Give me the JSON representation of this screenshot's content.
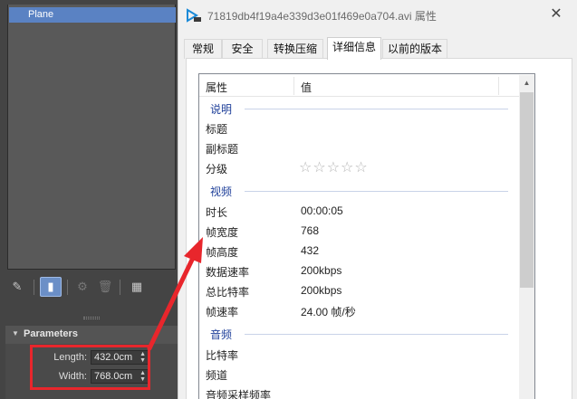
{
  "outliner": {
    "selected_item": "Plane"
  },
  "parameters": {
    "title": "Parameters",
    "length_label": "Length:",
    "length_value": "432.0cm",
    "width_label": "Width:",
    "width_value": "768.0cm"
  },
  "dialog": {
    "title": "71819db4f19a4e339d3e01f469e0a704.avi 属性",
    "close": "✕",
    "tabs": [
      "常规",
      "安全",
      "转换压缩",
      "详细信息",
      "以前的版本"
    ],
    "active_tab": "详细信息",
    "columns": {
      "property": "属性",
      "value": "值"
    },
    "groups": {
      "description": "说明",
      "video": "视频",
      "audio": "音频"
    },
    "rows": {
      "title": {
        "label": "标题",
        "value": ""
      },
      "subtitle": {
        "label": "副标题",
        "value": ""
      },
      "rating": {
        "label": "分级",
        "stars": "☆☆☆☆☆"
      },
      "length": {
        "label": "时长",
        "value": "00:00:05"
      },
      "frame_width": {
        "label": "帧宽度",
        "value": "768"
      },
      "frame_height": {
        "label": "帧高度",
        "value": "432"
      },
      "data_rate": {
        "label": "数据速率",
        "value": "200kbps"
      },
      "total_bitrate": {
        "label": "总比特率",
        "value": "200kbps"
      },
      "frame_rate": {
        "label": "帧速率",
        "value": "24.00 帧/秒"
      },
      "bitrate": {
        "label": "比特率",
        "value": ""
      },
      "channels": {
        "label": "频道",
        "value": ""
      },
      "audio_sample_rate": {
        "label": "音频采样频率",
        "value": ""
      }
    }
  },
  "colors": {
    "highlight_box": "#e8262c",
    "arrow": "#e8262c",
    "group_header": "#1e3f99",
    "selection": "#5a82c3"
  }
}
